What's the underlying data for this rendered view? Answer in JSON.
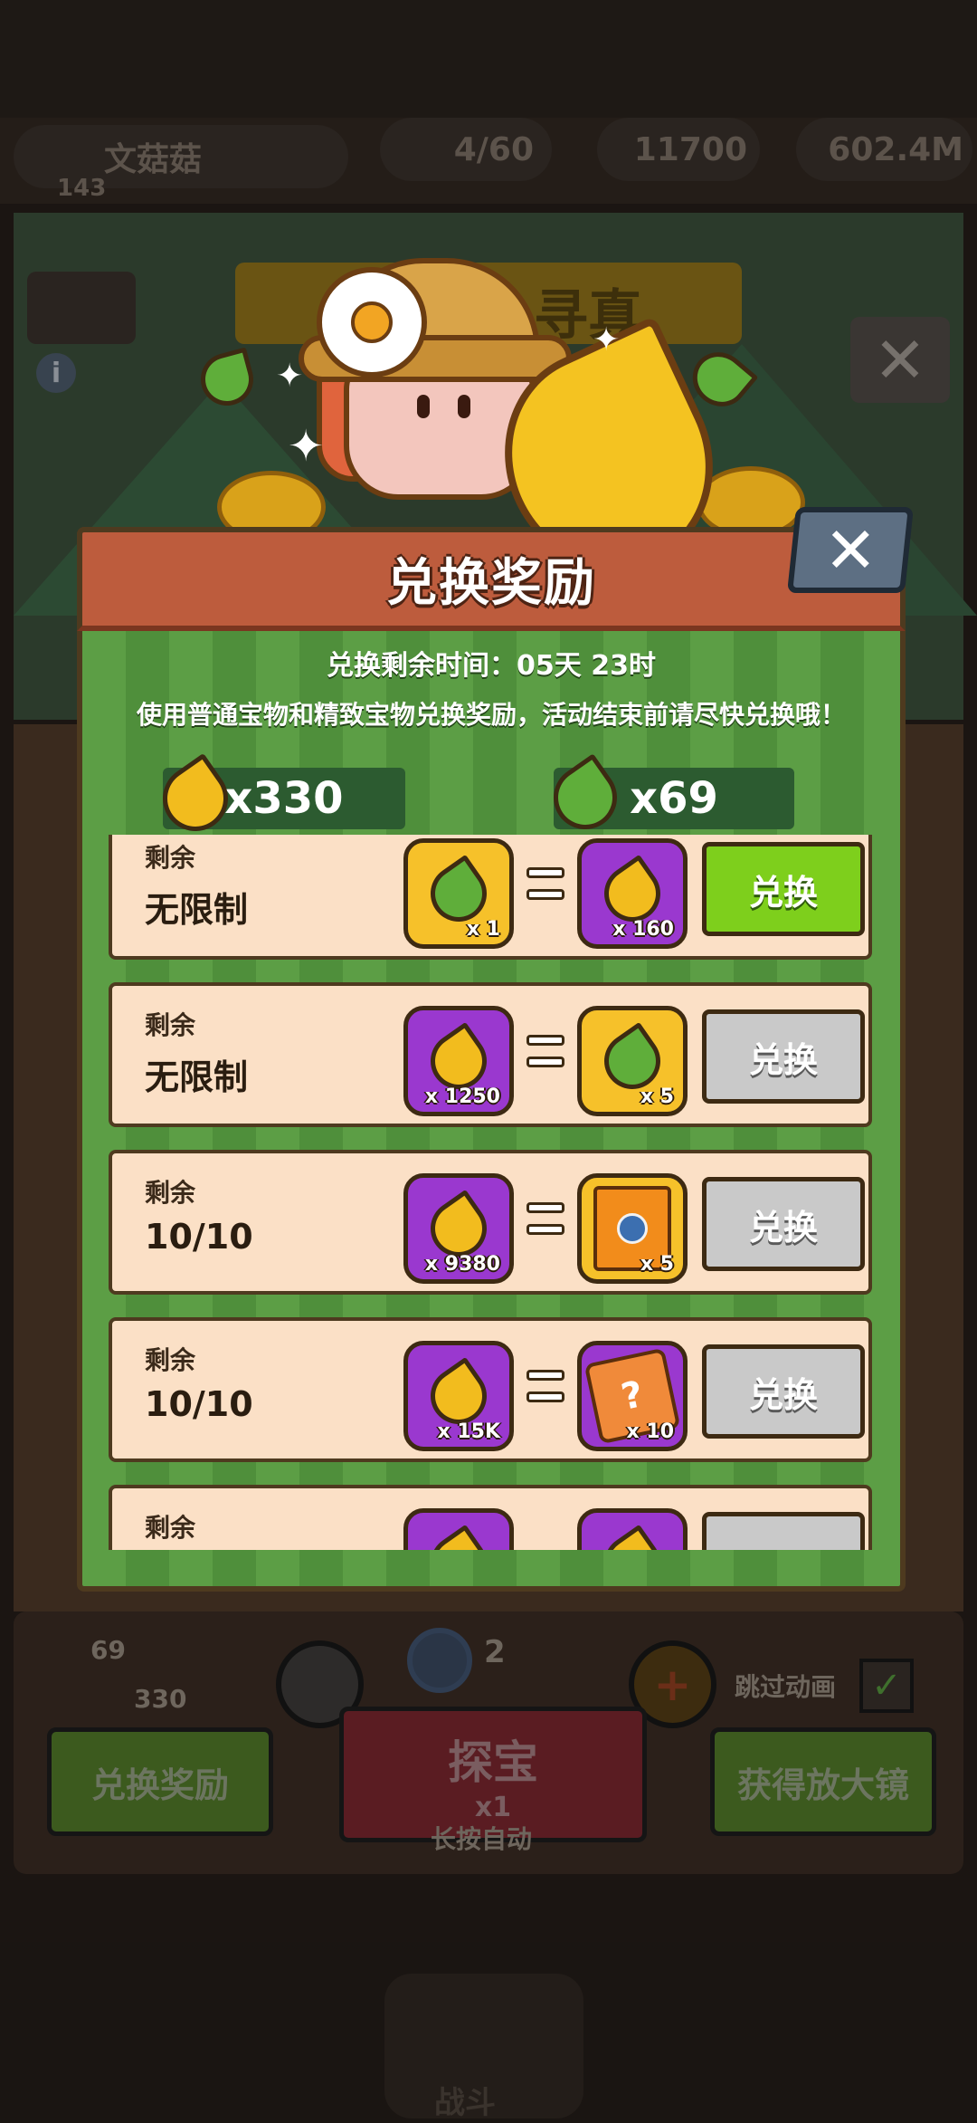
{
  "background": {
    "player_name": "文菇菇",
    "player_level": "143",
    "top_stats": [
      "4/60",
      "11700",
      "602.4M"
    ],
    "event_title": "寻真",
    "bottom_panel": {
      "green_leaf_count": "69",
      "gold_leaf_count": "330",
      "magnifier_count": "2",
      "skip_animation_label": "跳过动画",
      "exchange_button": "兑换奖励",
      "dig_button": "探宝",
      "dig_cost": "x1",
      "dig_hint": "长按自动",
      "get_magnifier_button": "获得放大镜"
    },
    "nav_battle_label": "战斗"
  },
  "modal": {
    "title": "兑换奖励",
    "close_symbol": "✕",
    "countdown": "兑换剩余时间：05天 23时",
    "description": "使用普通宝物和精致宝物兑换奖励，活动结束前请尽快兑换哦！",
    "balances": [
      {
        "icon": "gold-leaf-icon",
        "amount": "x330"
      },
      {
        "icon": "green-leaf-icon",
        "amount": "x69"
      }
    ],
    "rows": [
      {
        "remaining_label": "剩余",
        "remaining_value": "无限制",
        "cost_icon": "green-leaf-icon",
        "cost_qty": "x 1",
        "reward_icon": "gold-leaf-icon",
        "reward_qty": "x 160",
        "button": "兑换",
        "enabled": true
      },
      {
        "remaining_label": "剩余",
        "remaining_value": "无限制",
        "cost_icon": "gold-leaf-icon",
        "cost_qty": "x 1250",
        "reward_icon": "green-leaf-icon",
        "reward_qty": "x 5",
        "button": "兑换",
        "enabled": false
      },
      {
        "remaining_label": "剩余",
        "remaining_value": "10/10",
        "cost_icon": "gold-leaf-icon",
        "cost_qty": "x 9380",
        "reward_icon": "treasure-chest-icon",
        "reward_qty": "x 5",
        "button": "兑换",
        "enabled": false
      },
      {
        "remaining_label": "剩余",
        "remaining_value": "10/10",
        "cost_icon": "gold-leaf-icon",
        "cost_qty": "x 15K",
        "reward_icon": "puzzle-piece-icon",
        "reward_qty": "x 10",
        "button": "兑换",
        "enabled": false
      },
      {
        "remaining_label": "剩余",
        "remaining_value": "",
        "cost_icon": "gold-leaf-icon",
        "cost_qty": "",
        "reward_icon": "gold-leaf-icon",
        "reward_qty": "",
        "button": "",
        "enabled": false
      }
    ]
  },
  "colors": {
    "modal_header": "#bd5c3d",
    "modal_stripe_a": "#5c9e45",
    "modal_stripe_b": "#4f8f3b",
    "row_bg": "#fbe0c6",
    "button_active": "#7ecf1c",
    "button_disabled": "#c9c9c9",
    "item_yellow": "#f6c12a",
    "item_purple": "#9a38cf"
  }
}
